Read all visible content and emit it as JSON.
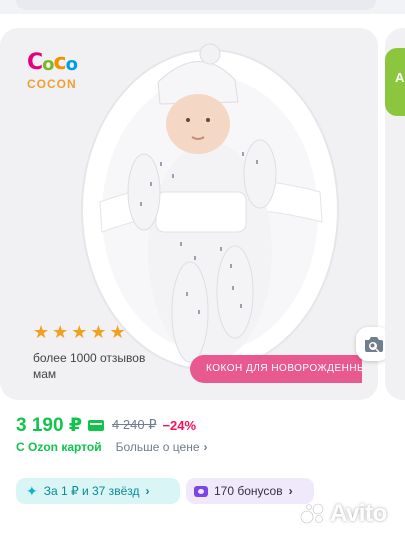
{
  "product_card": {
    "logo": {
      "brand": "Coco",
      "sub": "COCON"
    },
    "rating_stars": "★★★★★",
    "reviews_text": "более 1000 отзывов мам",
    "promo_banner": "КОКОН ДЛЯ НОВОРОЖДЕННЫХ",
    "similar_icon": "camera-search-icon"
  },
  "next_card": {
    "badge_letter": "А"
  },
  "price": {
    "current": "3 190 ₽",
    "old": "4 240 ₽",
    "discount": "−24%",
    "ozon_card_label": "С Ozon картой",
    "more_price_label": "Больше о цене",
    "more_price_chevron": "›"
  },
  "pills": {
    "stars_offer": "За 1 ₽ и 37 звёзд",
    "bonus_offer": "170 бонусов",
    "chevron": "›",
    "spark": "✦"
  },
  "watermark": {
    "text": "Avito"
  },
  "colors": {
    "price_green": "#10c44c",
    "discount_red": "#f91155",
    "promo_pink": "#e8598f",
    "card_bg": "#f1f1f4",
    "star_orange": "#f2a01e"
  }
}
